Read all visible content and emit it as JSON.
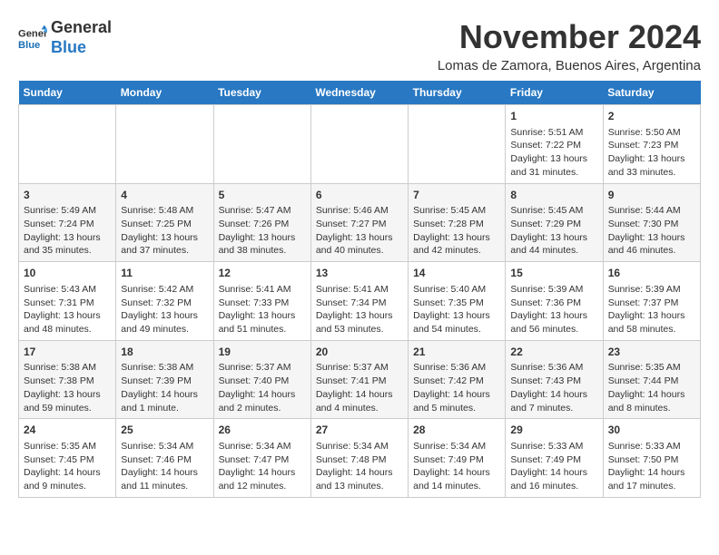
{
  "header": {
    "logo_line1": "General",
    "logo_line2": "Blue",
    "month": "November 2024",
    "location": "Lomas de Zamora, Buenos Aires, Argentina"
  },
  "days_of_week": [
    "Sunday",
    "Monday",
    "Tuesday",
    "Wednesday",
    "Thursday",
    "Friday",
    "Saturday"
  ],
  "weeks": [
    [
      {
        "day": "",
        "info": ""
      },
      {
        "day": "",
        "info": ""
      },
      {
        "day": "",
        "info": ""
      },
      {
        "day": "",
        "info": ""
      },
      {
        "day": "",
        "info": ""
      },
      {
        "day": "1",
        "info": "Sunrise: 5:51 AM\nSunset: 7:22 PM\nDaylight: 13 hours\nand 31 minutes."
      },
      {
        "day": "2",
        "info": "Sunrise: 5:50 AM\nSunset: 7:23 PM\nDaylight: 13 hours\nand 33 minutes."
      }
    ],
    [
      {
        "day": "3",
        "info": "Sunrise: 5:49 AM\nSunset: 7:24 PM\nDaylight: 13 hours\nand 35 minutes."
      },
      {
        "day": "4",
        "info": "Sunrise: 5:48 AM\nSunset: 7:25 PM\nDaylight: 13 hours\nand 37 minutes."
      },
      {
        "day": "5",
        "info": "Sunrise: 5:47 AM\nSunset: 7:26 PM\nDaylight: 13 hours\nand 38 minutes."
      },
      {
        "day": "6",
        "info": "Sunrise: 5:46 AM\nSunset: 7:27 PM\nDaylight: 13 hours\nand 40 minutes."
      },
      {
        "day": "7",
        "info": "Sunrise: 5:45 AM\nSunset: 7:28 PM\nDaylight: 13 hours\nand 42 minutes."
      },
      {
        "day": "8",
        "info": "Sunrise: 5:45 AM\nSunset: 7:29 PM\nDaylight: 13 hours\nand 44 minutes."
      },
      {
        "day": "9",
        "info": "Sunrise: 5:44 AM\nSunset: 7:30 PM\nDaylight: 13 hours\nand 46 minutes."
      }
    ],
    [
      {
        "day": "10",
        "info": "Sunrise: 5:43 AM\nSunset: 7:31 PM\nDaylight: 13 hours\nand 48 minutes."
      },
      {
        "day": "11",
        "info": "Sunrise: 5:42 AM\nSunset: 7:32 PM\nDaylight: 13 hours\nand 49 minutes."
      },
      {
        "day": "12",
        "info": "Sunrise: 5:41 AM\nSunset: 7:33 PM\nDaylight: 13 hours\nand 51 minutes."
      },
      {
        "day": "13",
        "info": "Sunrise: 5:41 AM\nSunset: 7:34 PM\nDaylight: 13 hours\nand 53 minutes."
      },
      {
        "day": "14",
        "info": "Sunrise: 5:40 AM\nSunset: 7:35 PM\nDaylight: 13 hours\nand 54 minutes."
      },
      {
        "day": "15",
        "info": "Sunrise: 5:39 AM\nSunset: 7:36 PM\nDaylight: 13 hours\nand 56 minutes."
      },
      {
        "day": "16",
        "info": "Sunrise: 5:39 AM\nSunset: 7:37 PM\nDaylight: 13 hours\nand 58 minutes."
      }
    ],
    [
      {
        "day": "17",
        "info": "Sunrise: 5:38 AM\nSunset: 7:38 PM\nDaylight: 13 hours\nand 59 minutes."
      },
      {
        "day": "18",
        "info": "Sunrise: 5:38 AM\nSunset: 7:39 PM\nDaylight: 14 hours\nand 1 minute."
      },
      {
        "day": "19",
        "info": "Sunrise: 5:37 AM\nSunset: 7:40 PM\nDaylight: 14 hours\nand 2 minutes."
      },
      {
        "day": "20",
        "info": "Sunrise: 5:37 AM\nSunset: 7:41 PM\nDaylight: 14 hours\nand 4 minutes."
      },
      {
        "day": "21",
        "info": "Sunrise: 5:36 AM\nSunset: 7:42 PM\nDaylight: 14 hours\nand 5 minutes."
      },
      {
        "day": "22",
        "info": "Sunrise: 5:36 AM\nSunset: 7:43 PM\nDaylight: 14 hours\nand 7 minutes."
      },
      {
        "day": "23",
        "info": "Sunrise: 5:35 AM\nSunset: 7:44 PM\nDaylight: 14 hours\nand 8 minutes."
      }
    ],
    [
      {
        "day": "24",
        "info": "Sunrise: 5:35 AM\nSunset: 7:45 PM\nDaylight: 14 hours\nand 9 minutes."
      },
      {
        "day": "25",
        "info": "Sunrise: 5:34 AM\nSunset: 7:46 PM\nDaylight: 14 hours\nand 11 minutes."
      },
      {
        "day": "26",
        "info": "Sunrise: 5:34 AM\nSunset: 7:47 PM\nDaylight: 14 hours\nand 12 minutes."
      },
      {
        "day": "27",
        "info": "Sunrise: 5:34 AM\nSunset: 7:48 PM\nDaylight: 14 hours\nand 13 minutes."
      },
      {
        "day": "28",
        "info": "Sunrise: 5:34 AM\nSunset: 7:49 PM\nDaylight: 14 hours\nand 14 minutes."
      },
      {
        "day": "29",
        "info": "Sunrise: 5:33 AM\nSunset: 7:49 PM\nDaylight: 14 hours\nand 16 minutes."
      },
      {
        "day": "30",
        "info": "Sunrise: 5:33 AM\nSunset: 7:50 PM\nDaylight: 14 hours\nand 17 minutes."
      }
    ]
  ]
}
